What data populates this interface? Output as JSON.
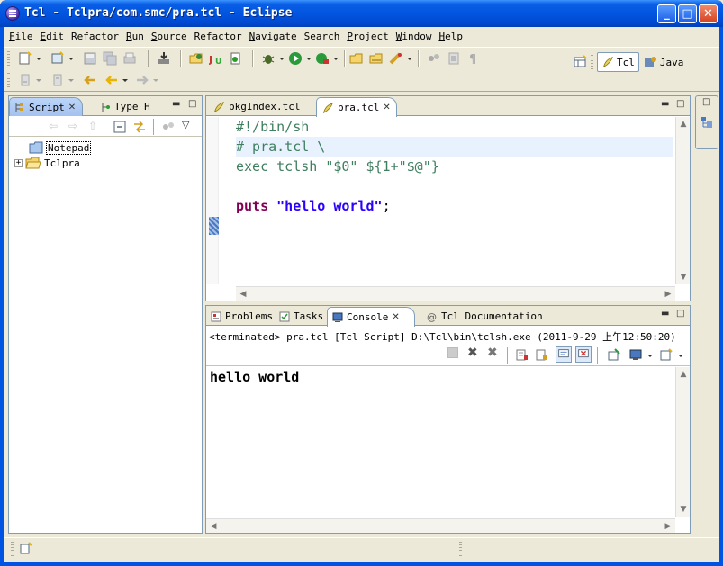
{
  "window": {
    "title": "Tcl - Tclpra/com.smc/pra.tcl - Eclipse"
  },
  "menu": [
    {
      "u": "F",
      "rest": "ile"
    },
    {
      "u": "E",
      "rest": "dit"
    },
    {
      "u": "",
      "rest": "Refactor"
    },
    {
      "u": "R",
      "rest": "un"
    },
    {
      "u": "S",
      "rest": "ource"
    },
    {
      "u": "",
      "rest": "Refactor"
    },
    {
      "u": "N",
      "rest": "avigate"
    },
    {
      "u": "",
      "rest": "Search"
    },
    {
      "u": "P",
      "rest": "roject"
    },
    {
      "u": "W",
      "rest": "indow"
    },
    {
      "u": "H",
      "rest": "elp"
    }
  ],
  "perspectives": {
    "tcl": "Tcl",
    "java": "Java"
  },
  "left_pane": {
    "tabs": [
      "Script",
      "Type H"
    ],
    "tree": [
      {
        "label": "Notepad",
        "expander": ""
      },
      {
        "label": "Tclpra",
        "expander": "+"
      }
    ]
  },
  "editor": {
    "tabs": [
      "pkgIndex.tcl",
      "pra.tcl"
    ],
    "lines": [
      {
        "text": "#!/bin/sh"
      },
      {
        "text": "# pra.tcl \\"
      },
      {
        "text": "exec tclsh \"$0\" ${1+\"$@\"}"
      },
      {
        "text": ""
      },
      {
        "kw": "puts",
        "str": "\"hello world\"",
        "end": ";"
      }
    ]
  },
  "console_pane": {
    "tabs": [
      "Problems",
      "Tasks",
      "Console",
      "Tcl Documentation"
    ],
    "terminated": "<terminated> pra.tcl [Tcl Script] D:\\Tcl\\bin\\tclsh.exe (2011-9-29 上午12:50:20)",
    "output": "hello world"
  },
  "colors": {
    "comment": "#3f7f5f",
    "keyword": "#7f0055",
    "string": "#2a00ff",
    "titlebar": "#0054e3"
  }
}
